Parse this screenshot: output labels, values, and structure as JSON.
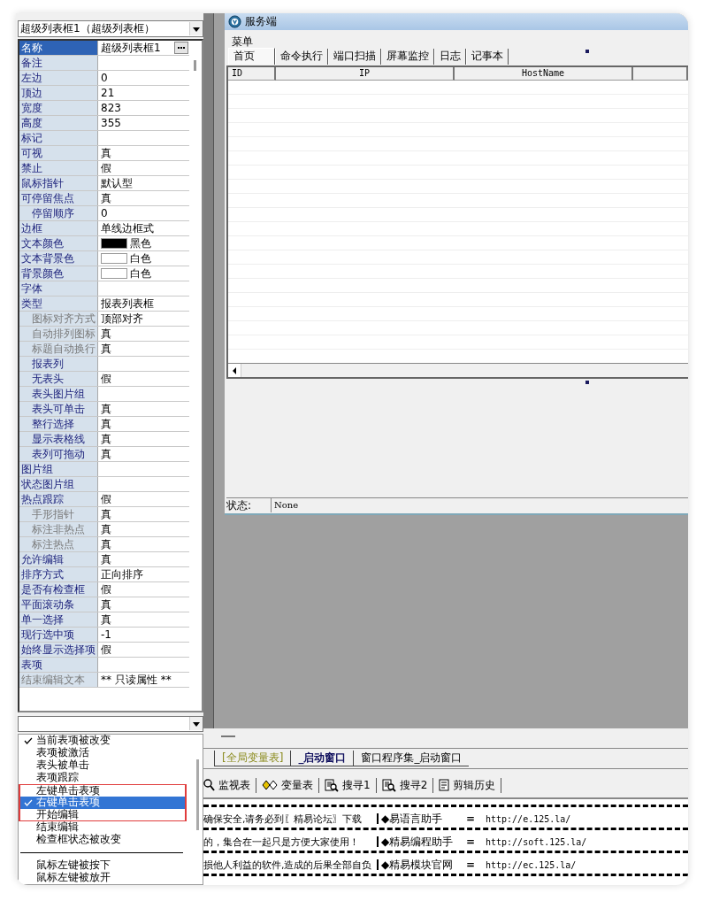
{
  "object_selector": {
    "value": "超级列表框1（超级列表框）"
  },
  "properties": [
    {
      "name": "名称",
      "value": "超级列表框1",
      "kind": "button",
      "selected": true,
      "indented": false,
      "disabled": false
    },
    {
      "name": "备注",
      "kind": "text",
      "selected": false,
      "indented": false,
      "disabled": false
    },
    {
      "name": "左边",
      "value": "0",
      "kind": "text",
      "selected": false,
      "indented": false,
      "disabled": false
    },
    {
      "name": "顶边",
      "value": "21",
      "kind": "text",
      "selected": false,
      "indented": false,
      "disabled": false
    },
    {
      "name": "宽度",
      "value": "823",
      "kind": "text",
      "selected": false,
      "indented": false,
      "disabled": false
    },
    {
      "name": "高度",
      "value": "355",
      "kind": "text",
      "selected": false,
      "indented": false,
      "disabled": false
    },
    {
      "name": "标记",
      "kind": "text",
      "selected": false,
      "indented": false,
      "disabled": false
    },
    {
      "name": "可视",
      "value": "真",
      "kind": "text",
      "selected": false,
      "indented": false,
      "disabled": false
    },
    {
      "name": "禁止",
      "value": "假",
      "kind": "text",
      "selected": false,
      "indented": false,
      "disabled": false
    },
    {
      "name": "鼠标指针",
      "value": "默认型",
      "kind": "text",
      "selected": false,
      "indented": false,
      "disabled": false
    },
    {
      "name": "可停留焦点",
      "value": "真",
      "kind": "text",
      "selected": false,
      "indented": false,
      "disabled": false
    },
    {
      "name": "停留顺序",
      "value": "0",
      "kind": "text",
      "selected": false,
      "indented": true,
      "disabled": false
    },
    {
      "name": "边框",
      "value": "单线边框式",
      "kind": "text",
      "selected": false,
      "indented": false,
      "disabled": false
    },
    {
      "name": "文本颜色",
      "value": "黑色",
      "kind": "color",
      "color": "#000000",
      "selected": false,
      "indented": false,
      "disabled": false
    },
    {
      "name": "文本背景色",
      "value": "白色",
      "kind": "color",
      "color": "#ffffff",
      "selected": false,
      "indented": false,
      "disabled": false
    },
    {
      "name": "背景颜色",
      "value": "白色",
      "kind": "color",
      "color": "#ffffff",
      "selected": false,
      "indented": false,
      "disabled": false
    },
    {
      "name": "字体",
      "kind": "text",
      "selected": false,
      "indented": false,
      "disabled": false
    },
    {
      "name": "类型",
      "value": "报表列表框",
      "kind": "text",
      "selected": false,
      "indented": false,
      "disabled": false
    },
    {
      "name": "图标对齐方式",
      "value": "顶部对齐",
      "kind": "text",
      "selected": false,
      "indented": true,
      "disabled": true
    },
    {
      "name": "自动排列图标",
      "value": "真",
      "kind": "text",
      "selected": false,
      "indented": true,
      "disabled": true
    },
    {
      "name": "标题自动换行",
      "value": "真",
      "kind": "text",
      "selected": false,
      "indented": true,
      "disabled": true
    },
    {
      "name": "报表列",
      "kind": "text",
      "selected": false,
      "indented": true,
      "disabled": false
    },
    {
      "name": "无表头",
      "value": "假",
      "kind": "text",
      "selected": false,
      "indented": true,
      "disabled": false
    },
    {
      "name": "表头图片组",
      "kind": "text",
      "selected": false,
      "indented": true,
      "disabled": false
    },
    {
      "name": "表头可单击",
      "value": "真",
      "kind": "text",
      "selected": false,
      "indented": true,
      "disabled": false
    },
    {
      "name": "整行选择",
      "value": "真",
      "kind": "text",
      "selected": false,
      "indented": true,
      "disabled": false
    },
    {
      "name": "显示表格线",
      "value": "真",
      "kind": "text",
      "selected": false,
      "indented": true,
      "disabled": false
    },
    {
      "name": "表列可拖动",
      "value": "真",
      "kind": "text",
      "selected": false,
      "indented": true,
      "disabled": false
    },
    {
      "name": "图片组",
      "kind": "text",
      "selected": false,
      "indented": false,
      "disabled": false
    },
    {
      "name": "状态图片组",
      "kind": "text",
      "selected": false,
      "indented": false,
      "disabled": false
    },
    {
      "name": "热点跟踪",
      "value": "假",
      "kind": "text",
      "selected": false,
      "indented": false,
      "disabled": false
    },
    {
      "name": "手形指针",
      "value": "真",
      "kind": "text",
      "selected": false,
      "indented": true,
      "disabled": true
    },
    {
      "name": "标注非热点",
      "value": "真",
      "kind": "text",
      "selected": false,
      "indented": true,
      "disabled": true
    },
    {
      "name": "标注热点",
      "value": "真",
      "kind": "text",
      "selected": false,
      "indented": true,
      "disabled": true
    },
    {
      "name": "允许编辑",
      "value": "真",
      "kind": "text",
      "selected": false,
      "indented": false,
      "disabled": false
    },
    {
      "name": "排序方式",
      "value": "正向排序",
      "kind": "text",
      "selected": false,
      "indented": false,
      "disabled": false
    },
    {
      "name": "是否有检查框",
      "value": "假",
      "kind": "text",
      "selected": false,
      "indented": false,
      "disabled": false
    },
    {
      "name": "平面滚动条",
      "value": "真",
      "kind": "text",
      "selected": false,
      "indented": false,
      "disabled": false
    },
    {
      "name": "单一选择",
      "value": "真",
      "kind": "text",
      "selected": false,
      "indented": false,
      "disabled": false
    },
    {
      "name": "现行选中项",
      "value": "-1",
      "kind": "text",
      "selected": false,
      "indented": false,
      "disabled": false
    },
    {
      "name": "始终显示选择项",
      "value": "假",
      "kind": "text",
      "selected": false,
      "indented": false,
      "disabled": false
    },
    {
      "name": "表项",
      "kind": "text",
      "selected": false,
      "indented": false,
      "disabled": false
    },
    {
      "name": "结束编辑文本",
      "value": "** 只读属性 **",
      "kind": "text",
      "selected": false,
      "indented": false,
      "disabled": true
    }
  ],
  "event_list": [
    {
      "kind": "item",
      "label": "当前表项被改变",
      "checked": true,
      "selected": false,
      "highlighted": false
    },
    {
      "kind": "item",
      "label": "表项被激活",
      "checked": false,
      "selected": false,
      "highlighted": false
    },
    {
      "kind": "item",
      "label": "表头被单击",
      "checked": false,
      "selected": false,
      "highlighted": false
    },
    {
      "kind": "item",
      "label": "表项跟踪",
      "checked": false,
      "selected": false,
      "highlighted": false
    },
    {
      "kind": "item",
      "label": "左键单击表项",
      "checked": false,
      "selected": false,
      "highlighted": true
    },
    {
      "kind": "item",
      "label": "右键单击表项",
      "checked": true,
      "selected": true,
      "highlighted": true
    },
    {
      "kind": "item",
      "label": "开始编辑",
      "checked": false,
      "selected": false,
      "highlighted": true
    },
    {
      "kind": "item",
      "label": "结束编辑",
      "checked": false,
      "selected": false,
      "highlighted": false
    },
    {
      "kind": "item",
      "label": "检查框状态被改变",
      "checked": false,
      "selected": false,
      "highlighted": false
    },
    {
      "kind": "separator"
    },
    {
      "kind": "item",
      "label": "鼠标左键被按下",
      "checked": false,
      "selected": false,
      "highlighted": false
    },
    {
      "kind": "item",
      "label": "鼠标左键被放开",
      "checked": false,
      "selected": false,
      "highlighted": false
    }
  ],
  "form": {
    "title": "服务端",
    "menu": [
      "菜单"
    ],
    "tabs": [
      {
        "label": "首页",
        "selected": true
      },
      {
        "label": "命令执行",
        "selected": false
      },
      {
        "label": "端口扫描",
        "selected": false
      },
      {
        "label": "屏幕监控",
        "selected": false
      },
      {
        "label": "日志",
        "selected": false
      },
      {
        "label": "记事本",
        "selected": false
      }
    ],
    "table": {
      "columns": [
        "ID",
        "IP",
        "HostName"
      ]
    },
    "status": {
      "label": "状态:",
      "value": "None"
    }
  },
  "doc_tabs": [
    {
      "label": "[全局变量表]",
      "kind": "global",
      "selected": false
    },
    {
      "label": "_启动窗口",
      "kind": "window",
      "selected": true
    },
    {
      "label": "窗口程序集_启动窗口",
      "kind": "code",
      "selected": false
    }
  ],
  "tool_tabs": [
    {
      "label": "监视表",
      "kind": "watch"
    },
    {
      "label": "变量表",
      "kind": "variables"
    },
    {
      "label": "搜寻1",
      "kind": "search"
    },
    {
      "label": "搜寻2",
      "kind": "search"
    },
    {
      "label": "剪辑历史",
      "kind": "history"
    }
  ],
  "output_lines": [
    {
      "text": "确保安全,请务必到〖精易论坛〗下载",
      "site": "◆易语言助手",
      "sep": "=",
      "url": "http://e.125.la/"
    },
    {
      "text": "的，集合在一起只是方便大家使用！",
      "site": "◆精易编程助手",
      "sep": "=",
      "url": "http://soft.125.la/"
    },
    {
      "text": "损他人利益的软件,造成的后果全部自负",
      "site": "◆精易模块官网",
      "sep": "=",
      "url": "http://ec.125.la/"
    }
  ]
}
